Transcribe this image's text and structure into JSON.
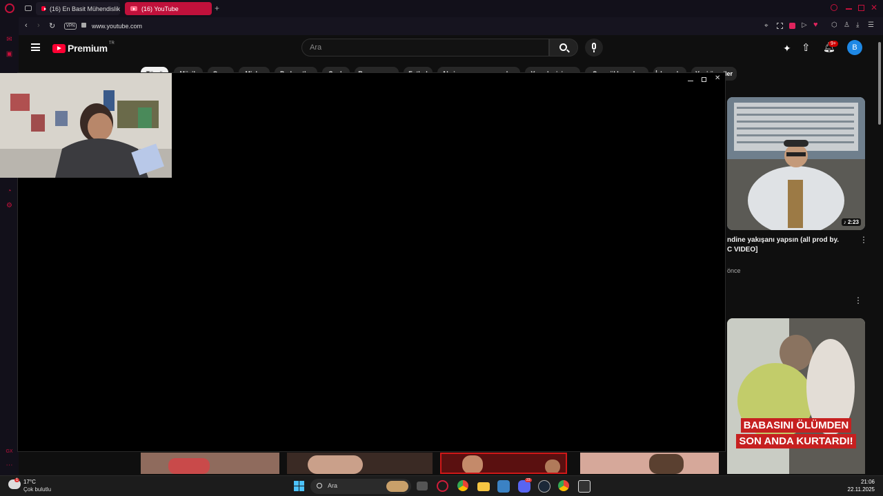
{
  "browser": {
    "tabs": [
      {
        "label": "(16) En Basit Mühendislik"
      },
      {
        "label": "(16) YouTube"
      }
    ],
    "vpn_label": "VPN",
    "url": "www.youtube.com"
  },
  "youtube": {
    "logo_text": "Premium",
    "logo_badge": "TR",
    "search_placeholder": "Ara",
    "notification_count": "9+",
    "avatar_letter": "B",
    "chips": [
      "Tümü",
      "Müzik",
      "Oyun",
      "Mixler",
      "Podcastler",
      "Canlı",
      "Rap yarışma",
      "Futbol",
      "Aksiyon macera oyunları",
      "Yemek pişirme",
      "Son yüklenenler",
      "İzlenenler",
      "Yeni öneriler"
    ],
    "videos": [
      {
        "title_line1": "ndine yakışanı yapsın (all prod by.",
        "title_line2": "C VIDEO]",
        "meta": "önce",
        "duration": "2:23"
      },
      {
        "thumbnail_text_1": "BABASINI ÖLÜMDEN",
        "thumbnail_text_2": "SON ANDA KURTARDI!"
      }
    ]
  },
  "taskbar": {
    "weather_temp": "17°C",
    "weather_desc": "Çok bulutlu",
    "weather_badge": "1",
    "search_placeholder": "Ara",
    "time": "21:06",
    "date": "22.11.2025",
    "discord_badge": "23"
  },
  "colors": {
    "accent": "#c4113b",
    "youtube_red": "#ff0033",
    "active_tab": "#c0113b",
    "avatar": "#1e88e5"
  }
}
